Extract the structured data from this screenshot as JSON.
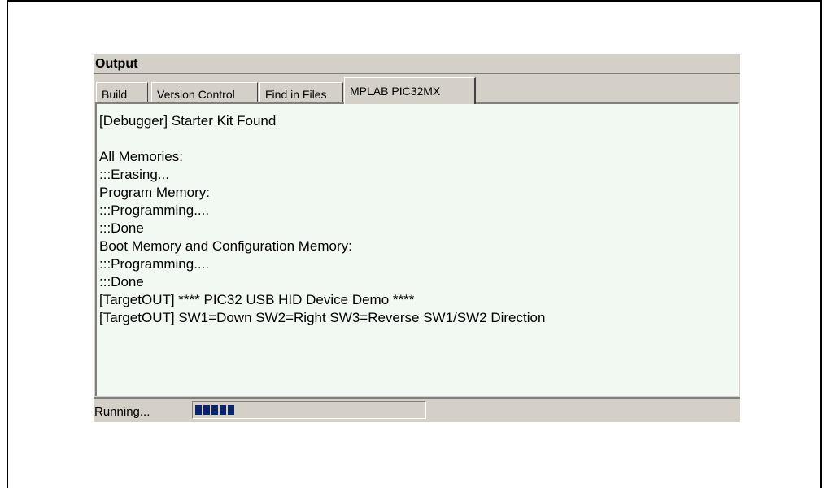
{
  "window": {
    "title": "Output"
  },
  "tabs": [
    {
      "label": "Build",
      "active": false
    },
    {
      "label": "Version Control",
      "active": false
    },
    {
      "label": "Find in Files",
      "active": false
    },
    {
      "label": "MPLAB PIC32MX",
      "active": true
    }
  ],
  "output": {
    "lines": [
      "[Debugger] Starter Kit Found",
      "",
      "All Memories:",
      ":::Erasing...",
      "Program Memory:",
      ":::Programming....",
      ":::Done",
      "Boot Memory and Configuration Memory:",
      ":::Programming....",
      ":::Done",
      "[TargetOUT] **** PIC32 USB HID Device Demo ****",
      "[TargetOUT] SW1=Down SW2=Right SW3=Reverse SW1/SW2 Direction"
    ]
  },
  "status": {
    "text": "Running...",
    "progress_blocks": 5,
    "progress_color": "#0a246a"
  }
}
